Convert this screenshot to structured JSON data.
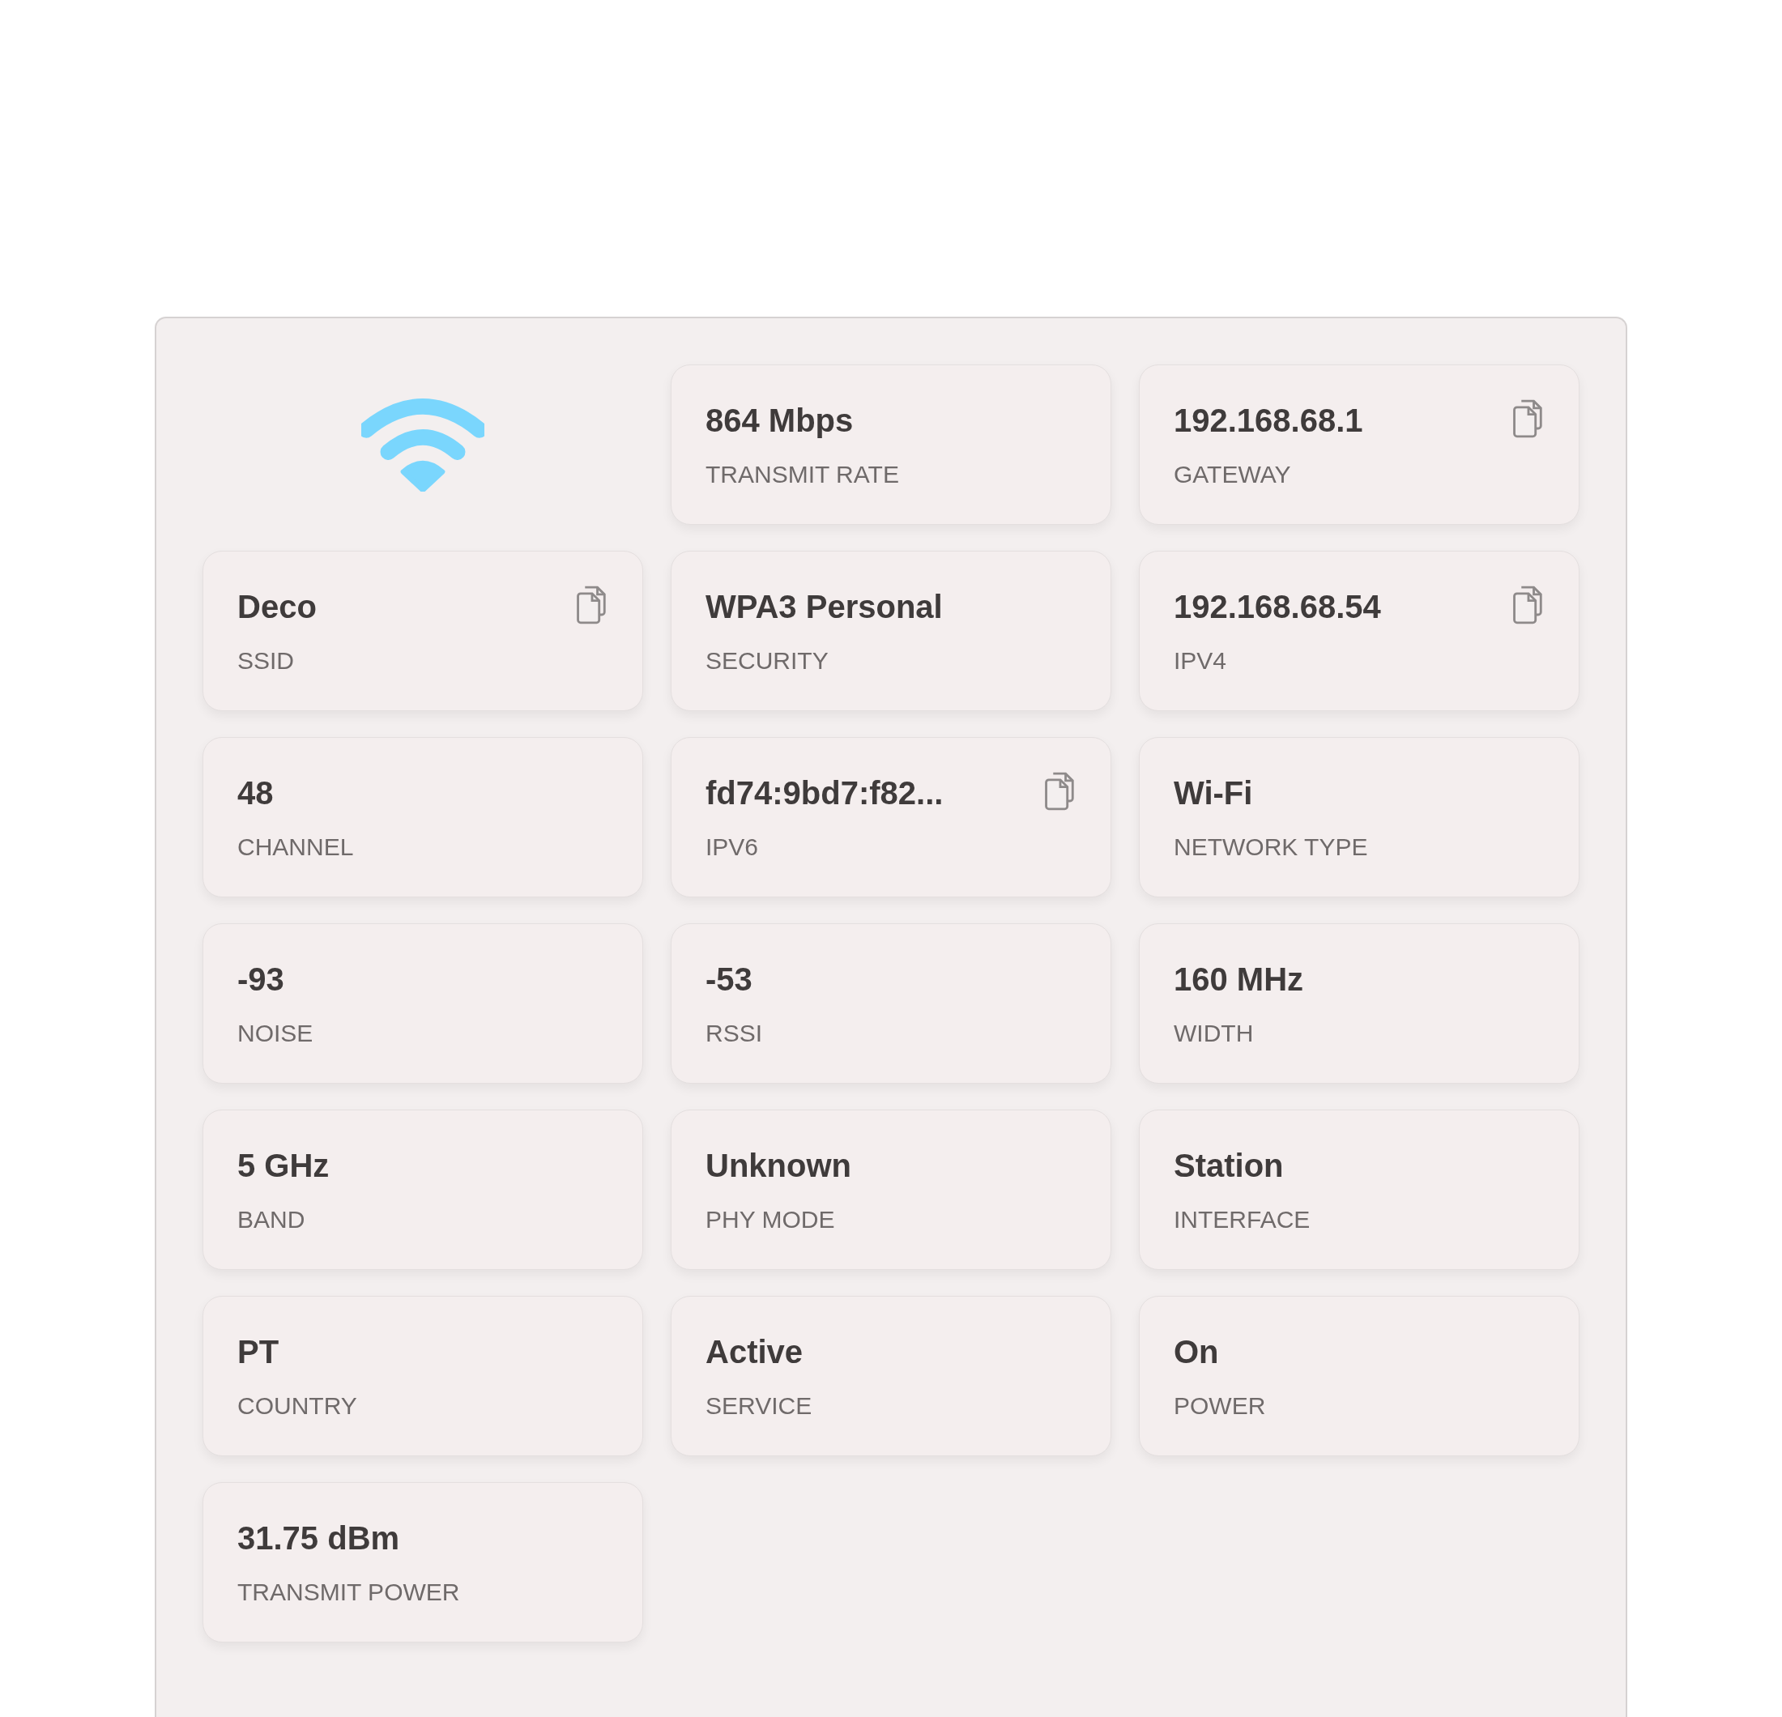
{
  "cards": [
    {
      "value": "864 Mbps",
      "label": "TRANSMIT RATE",
      "copyable": false
    },
    {
      "value": "192.168.68.1",
      "label": "GATEWAY",
      "copyable": true
    },
    {
      "value": "Deco",
      "label": "SSID",
      "copyable": true
    },
    {
      "value": "WPA3 Personal",
      "label": "SECURITY",
      "copyable": false
    },
    {
      "value": "192.168.68.54",
      "label": "IPV4",
      "copyable": true
    },
    {
      "value": "48",
      "label": "CHANNEL",
      "copyable": false
    },
    {
      "value": "fd74:9bd7:f82...",
      "label": "IPV6",
      "copyable": true
    },
    {
      "value": "Wi-Fi",
      "label": "NETWORK TYPE",
      "copyable": false
    },
    {
      "value": "-93",
      "label": "NOISE",
      "copyable": false
    },
    {
      "value": "-53",
      "label": "RSSI",
      "copyable": false
    },
    {
      "value": "160 MHz",
      "label": "WIDTH",
      "copyable": false
    },
    {
      "value": "5 GHz",
      "label": "BAND",
      "copyable": false
    },
    {
      "value": "Unknown",
      "label": "PHY MODE",
      "copyable": false
    },
    {
      "value": "Station",
      "label": "INTERFACE",
      "copyable": false
    },
    {
      "value": "PT",
      "label": "COUNTRY",
      "copyable": false
    },
    {
      "value": "Active",
      "label": "SERVICE",
      "copyable": false
    },
    {
      "value": "On",
      "label": "POWER",
      "copyable": false
    },
    {
      "value": "31.75 dBm",
      "label": "TRANSMIT POWER",
      "copyable": false
    }
  ]
}
